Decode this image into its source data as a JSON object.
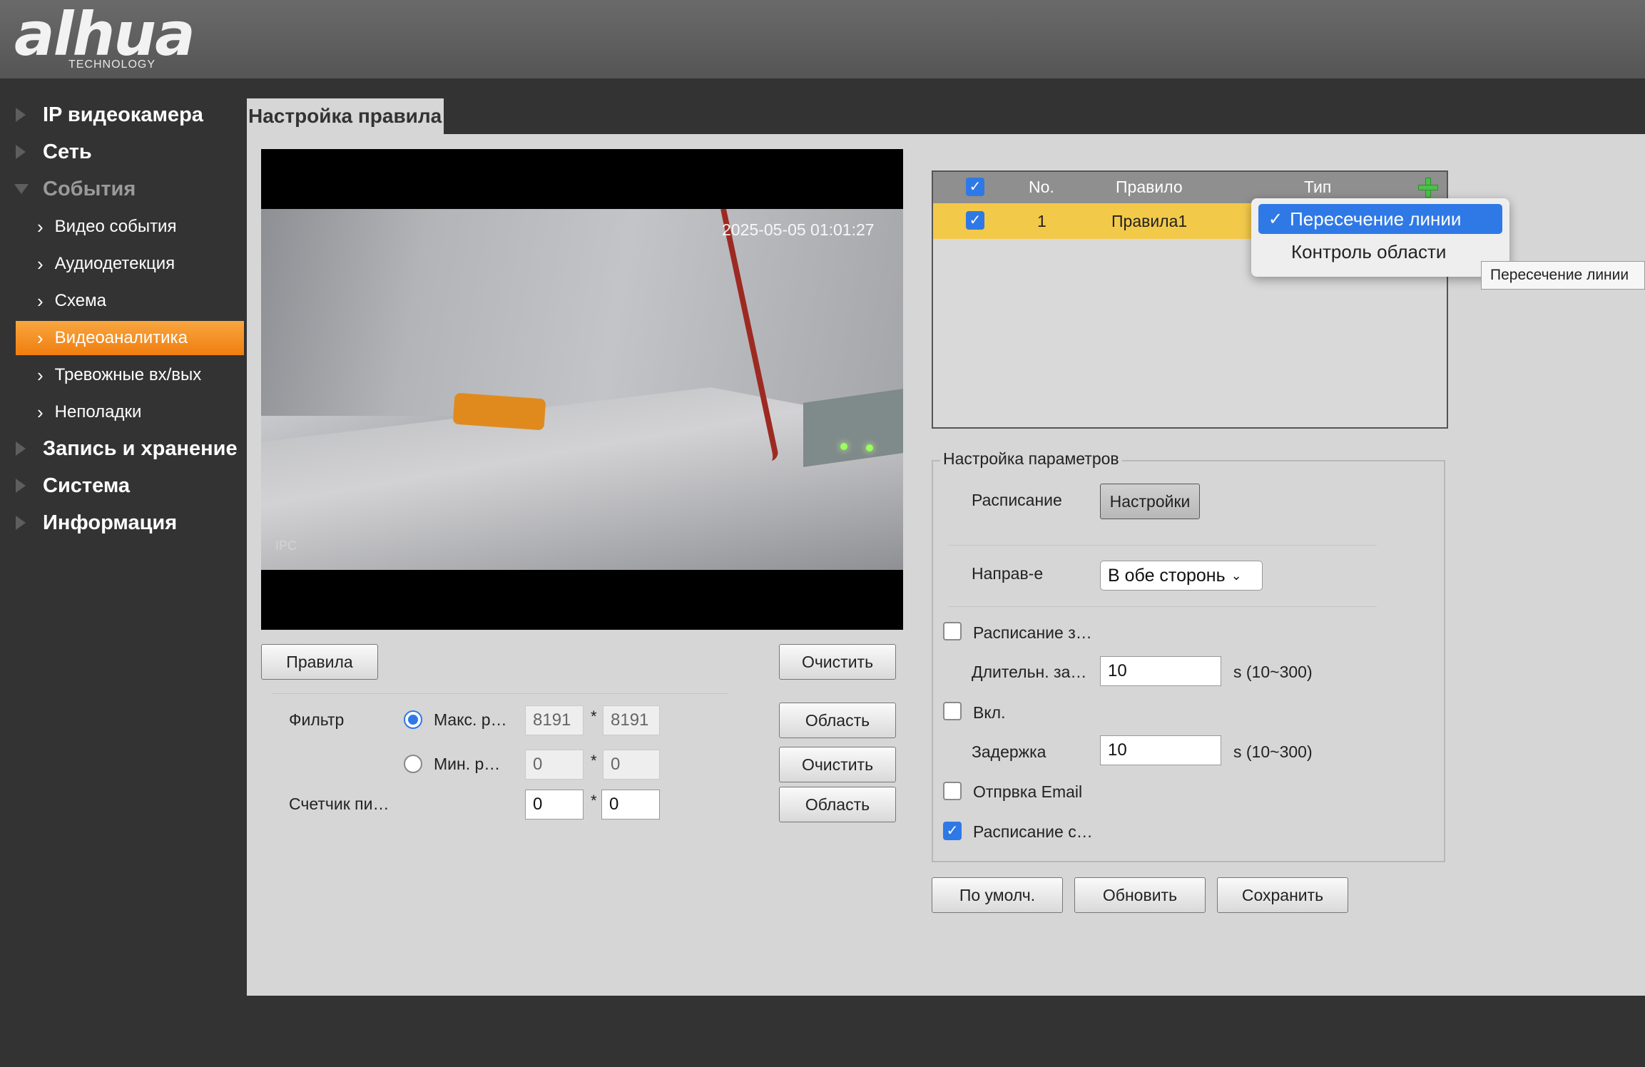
{
  "brand": {
    "logo": "alhua",
    "sub": "TECHNOLOGY"
  },
  "sidebar": {
    "top": [
      {
        "label": "IP видеокамера"
      },
      {
        "label": "Сеть"
      },
      {
        "label": "События"
      }
    ],
    "events_sub": [
      {
        "label": "Видео события"
      },
      {
        "label": "Аудиодетекция"
      },
      {
        "label": "Схема"
      },
      {
        "label": "Видеоаналитика"
      },
      {
        "label": "Тревожные вх/вых"
      },
      {
        "label": "Неполадки"
      }
    ],
    "bottom": [
      {
        "label": "Запись и хранение"
      },
      {
        "label": "Система"
      },
      {
        "label": "Информация"
      }
    ]
  },
  "tab": {
    "title": "Настройка правила"
  },
  "video": {
    "timestamp": "2025-05-05 01:01:27",
    "watermark": "IPC"
  },
  "left_panel": {
    "rules_button": "Правила",
    "clear_button": "Очистить",
    "filter_label": "Фильтр",
    "max_label": "Макс. р…",
    "min_label": "Мин. р…",
    "max_w": "8191",
    "max_h": "8191",
    "min_w": "0",
    "min_h": "0",
    "x_sep": "*",
    "area_button": "Область",
    "clear_button2": "Очистить",
    "area_button2": "Область",
    "counter_label": "Счетчик пи…",
    "counter_w": "0",
    "counter_h": "0"
  },
  "rules_table": {
    "headers": {
      "no": "No.",
      "rule": "Правило",
      "type": "Тип"
    },
    "rows": [
      {
        "no": "1",
        "rule": "Правила1"
      }
    ]
  },
  "type_dropdown": {
    "check_glyph": "✓",
    "options": [
      {
        "label": "Пересечение линии"
      },
      {
        "label": "Контроль области"
      }
    ],
    "tooltip": "Пересечение линии"
  },
  "params": {
    "legend": "Настройка параметров",
    "schedule_label": "Расписание",
    "schedule_button": "Настройки",
    "direction_label": "Направ-е",
    "direction_value": "В обе сторонь",
    "direction_arrow": "⌄",
    "record_label": "Расписание з…",
    "record_duration_label": "Длительн. за…",
    "record_duration_value": "10",
    "record_duration_unit": "s (10~300)",
    "enable_label": "Вкл.",
    "delay_label": "Задержка",
    "delay_value": "10",
    "delay_unit": "s (10~300)",
    "email_label": "Отпрвка Email",
    "snapshot_label": "Расписание с…",
    "check_glyph": "✓"
  },
  "footer": {
    "default_button": "По умолч.",
    "refresh_button": "Обновить",
    "save_button": "Сохранить"
  },
  "colors": {
    "accent_orange": "#f07e10",
    "selected_row": "#f3c94a",
    "checkbox_blue": "#2f79e6",
    "sidebar_bg": "#333333",
    "panel_bg": "#d6d6d6"
  }
}
